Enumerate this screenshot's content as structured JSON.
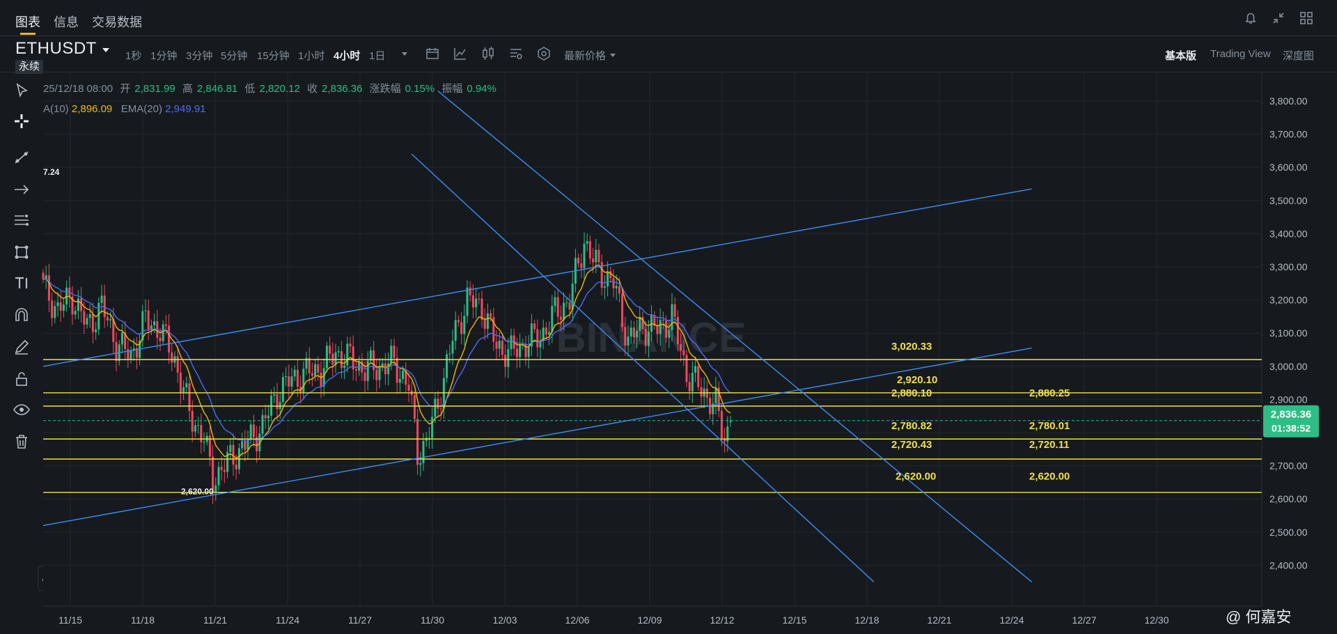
{
  "top_tabs": [
    {
      "label": "图表",
      "active": true
    },
    {
      "label": "信息",
      "active": false
    },
    {
      "label": "交易数据",
      "active": false
    }
  ],
  "top_icons": [
    "bell-icon",
    "collapse-arrows-icon",
    "layout-grid-icon"
  ],
  "symbol": "ETHUSDT",
  "contract_type": "永续",
  "intervals": [
    {
      "label": "1秒"
    },
    {
      "label": "1分钟"
    },
    {
      "label": "3分钟"
    },
    {
      "label": "5分钟"
    },
    {
      "label": "15分钟"
    },
    {
      "label": "1小时"
    },
    {
      "label": "4小时",
      "active": true
    },
    {
      "label": "1日"
    }
  ],
  "price_type": "最新价格",
  "views": [
    {
      "label": "基本版",
      "active": true
    },
    {
      "label": "Trading View"
    },
    {
      "label": "深度图"
    }
  ],
  "ohlc": {
    "time": "25/12/18 08:00",
    "open_label": "开",
    "open": "2,831.99",
    "high_label": "高",
    "high": "2,846.81",
    "low_label": "低",
    "low": "2,820.12",
    "close_label": "收",
    "close": "2,836.36",
    "change_label": "涨跌幅",
    "change": "0.15%",
    "amp_label": "振幅",
    "amp": "0.94%"
  },
  "indicators": {
    "ema10_label": "A(10)",
    "ema10": "2,896.09",
    "ema20_label": "EMA(20)",
    "ema20": "2,949.91",
    "clipped_label": "7.24"
  },
  "left_tools": [
    "cursor-icon",
    "crosshair-icon",
    "trend-line-icon",
    "arrow-icon",
    "fib-icon",
    "pattern-icon",
    "text-icon",
    "magnet-icon",
    "edit-icon",
    "lock-icon",
    "eye-icon",
    "trash-icon"
  ],
  "colors": {
    "up": "#2ebd85",
    "down": "#f6465d",
    "ema_fast": "#f0b90b",
    "ema_slow": "#4a6cf7",
    "hline": "#f0e04a",
    "trend": "#3a8ef6",
    "price_tag": "#2ebd85"
  },
  "price_axis": {
    "ticks": [
      "3,800.00",
      "3,700.00",
      "3,600.00",
      "3,500.00",
      "3,400.00",
      "3,300.00",
      "3,200.00",
      "3,100.00",
      "3,000.00",
      "2,900.00",
      "2,800.00",
      "2,700.00",
      "2,600.00",
      "2,500.00",
      "2,400.00"
    ],
    "last_price": "2,836.36",
    "countdown": "01:38:52"
  },
  "time_axis": [
    "11/15",
    "11/18",
    "11/21",
    "11/24",
    "11/27",
    "11/30",
    "12/03",
    "12/06",
    "12/09",
    "12/12",
    "12/15",
    "12/18",
    "12/21",
    "12/24",
    "12/27",
    "12/30"
  ],
  "level_labels": [
    {
      "text": "3,020.33"
    },
    {
      "text": "2,920.10"
    },
    {
      "text": "2,880.10"
    },
    {
      "text": "2,880.25"
    },
    {
      "text": "2,780.82"
    },
    {
      "text": "2,780.01"
    },
    {
      "text": "2,720.43"
    },
    {
      "text": "2,720.11"
    },
    {
      "text": "2,620.00"
    },
    {
      "text": "2,620.00"
    },
    {
      "text": "2,620.00"
    }
  ],
  "watermark": "@ 何嘉安",
  "chart_data": {
    "type": "candlestick",
    "symbol": "ETHUSDT",
    "timeframe": "4小时",
    "y_range": [
      2350,
      3850
    ],
    "x_ticks": [
      "11/15",
      "11/18",
      "11/21",
      "11/24",
      "11/27",
      "11/30",
      "12/03",
      "12/06",
      "12/09",
      "12/12",
      "12/15",
      "12/18",
      "12/21",
      "12/24",
      "12/27",
      "12/30"
    ],
    "horizontal_levels": [
      3020.33,
      2920.1,
      2880.1,
      2780.82,
      2720.43,
      2620.0
    ],
    "close_path": [
      [
        0,
        3240
      ],
      [
        5,
        3170
      ],
      [
        10,
        3210
      ],
      [
        15,
        3120
      ],
      [
        20,
        3180
      ],
      [
        25,
        3070
      ],
      [
        30,
        3030
      ],
      [
        35,
        3140
      ],
      [
        40,
        3110
      ],
      [
        45,
        3020
      ],
      [
        50,
        2860
      ],
      [
        55,
        2780
      ],
      [
        58,
        2660
      ],
      [
        61,
        2690
      ],
      [
        65,
        2730
      ],
      [
        70,
        2770
      ],
      [
        75,
        2820
      ],
      [
        80,
        2920
      ],
      [
        85,
        2960
      ],
      [
        90,
        2980
      ],
      [
        95,
        2990
      ],
      [
        100,
        3040
      ],
      [
        105,
        3020
      ],
      [
        110,
        2990
      ],
      [
        115,
        3000
      ],
      [
        120,
        3010
      ],
      [
        125,
        2940
      ],
      [
        128,
        2740
      ],
      [
        131,
        2770
      ],
      [
        135,
        2890
      ],
      [
        140,
        3080
      ],
      [
        145,
        3200
      ],
      [
        150,
        3180
      ],
      [
        155,
        3060
      ],
      [
        160,
        3040
      ],
      [
        165,
        3070
      ],
      [
        170,
        3090
      ],
      [
        175,
        3160
      ],
      [
        180,
        3200
      ],
      [
        185,
        3380
      ],
      [
        188,
        3320
      ],
      [
        190,
        3290
      ],
      [
        195,
        3250
      ],
      [
        200,
        3080
      ],
      [
        205,
        3120
      ],
      [
        210,
        3110
      ],
      [
        215,
        3150
      ],
      [
        220,
        2980
      ],
      [
        225,
        2930
      ],
      [
        230,
        2880
      ],
      [
        233,
        2780
      ],
      [
        235,
        2836
      ]
    ],
    "last_close": 2836.36
  }
}
